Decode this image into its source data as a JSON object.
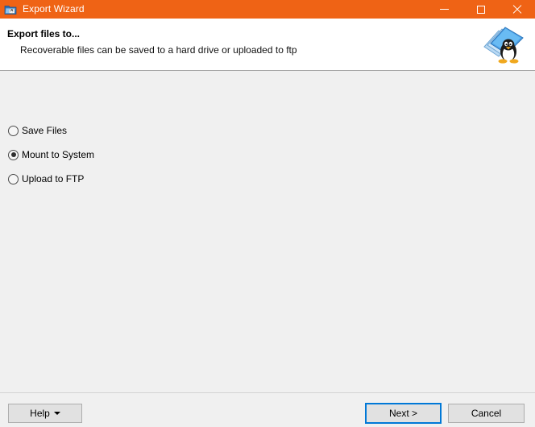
{
  "window": {
    "title": "Export Wizard",
    "icon": "export-wizard-icon",
    "accent_color": "#ef6315",
    "controls": [
      {
        "name": "minimize",
        "glyph": "—"
      },
      {
        "name": "maximize",
        "glyph": "□"
      },
      {
        "name": "close",
        "glyph": "✕"
      }
    ]
  },
  "header": {
    "title": "Export files to...",
    "subtitle": "Recoverable files can be saved to a hard drive or uploaded to ftp",
    "logo": "linux-penguin-disks-logo"
  },
  "main": {
    "options": [
      {
        "label": "Save Files",
        "selected": false
      },
      {
        "label": "Mount to System",
        "selected": true
      },
      {
        "label": "Upload to FTP",
        "selected": false
      }
    ]
  },
  "footer": {
    "help_label": "Help",
    "next_label": "Next >",
    "cancel_label": "Cancel",
    "focus_color": "#0078d7"
  }
}
